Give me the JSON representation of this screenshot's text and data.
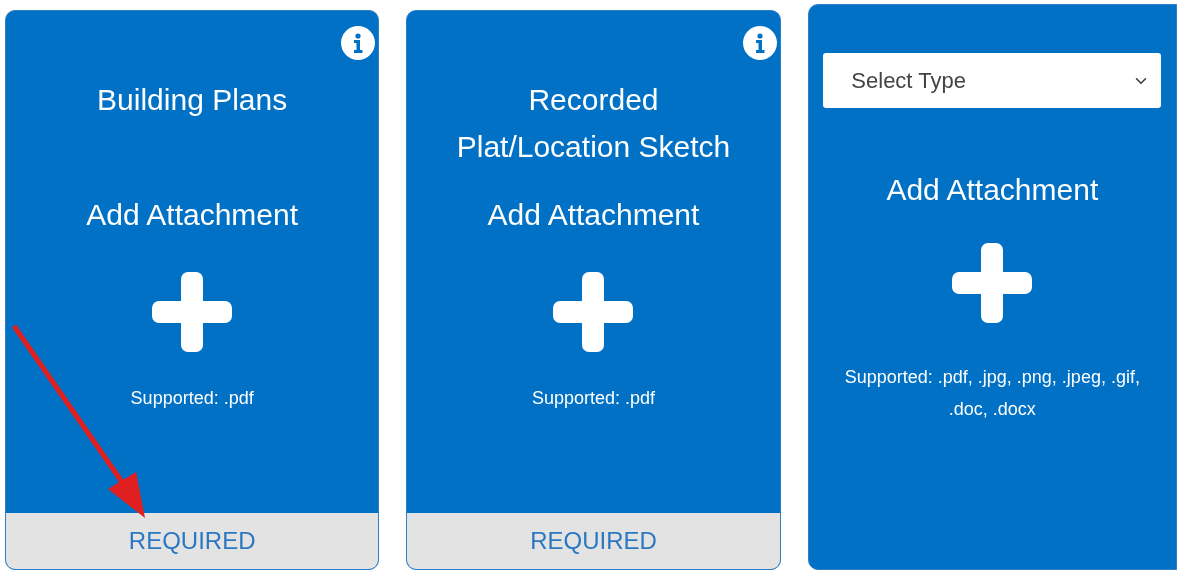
{
  "cards": [
    {
      "kind": "titled",
      "title": "Building Plans",
      "info": true,
      "action": "Add Attachment",
      "supported": "Supported: .pdf",
      "footer": "REQUIRED"
    },
    {
      "kind": "titled",
      "title": "Recorded Plat/Location Sketch",
      "info": true,
      "action": "Add Attachment",
      "supported": "Supported: .pdf",
      "footer": "REQUIRED"
    },
    {
      "kind": "typed",
      "select": {
        "value": "Select Type"
      },
      "action": "Add Attachment",
      "supported": "Supported: .pdf, .jpg, .png, .jpeg, .gif, .doc, .docx"
    }
  ],
  "annotations": [
    {
      "kind": "arrow"
    }
  ]
}
